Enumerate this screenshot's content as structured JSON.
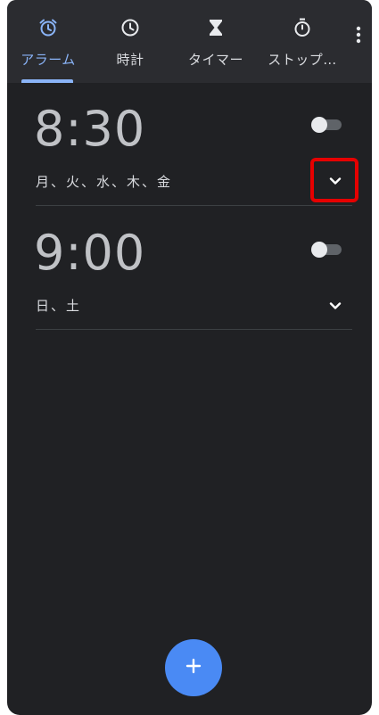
{
  "tabs": [
    {
      "label": "アラーム",
      "icon": "alarm-clock-icon",
      "active": true
    },
    {
      "label": "時計",
      "icon": "clock-icon",
      "active": false
    },
    {
      "label": "タイマー",
      "icon": "hourglass-icon",
      "active": false
    },
    {
      "label": "ストップ…",
      "icon": "stopwatch-icon",
      "active": false
    }
  ],
  "overflow_icon": "more-vert-icon",
  "alarms": [
    {
      "time": "8:30",
      "days": "月、火、水、木、金",
      "enabled": false
    },
    {
      "time": "9:00",
      "days": "日、土",
      "enabled": false
    }
  ],
  "fab_label": "+",
  "colors": {
    "background": "#202124",
    "tabbar": "#2b2c30",
    "accent": "#8ab4f8",
    "fab": "#4a8af4",
    "highlight": "#e60000"
  }
}
